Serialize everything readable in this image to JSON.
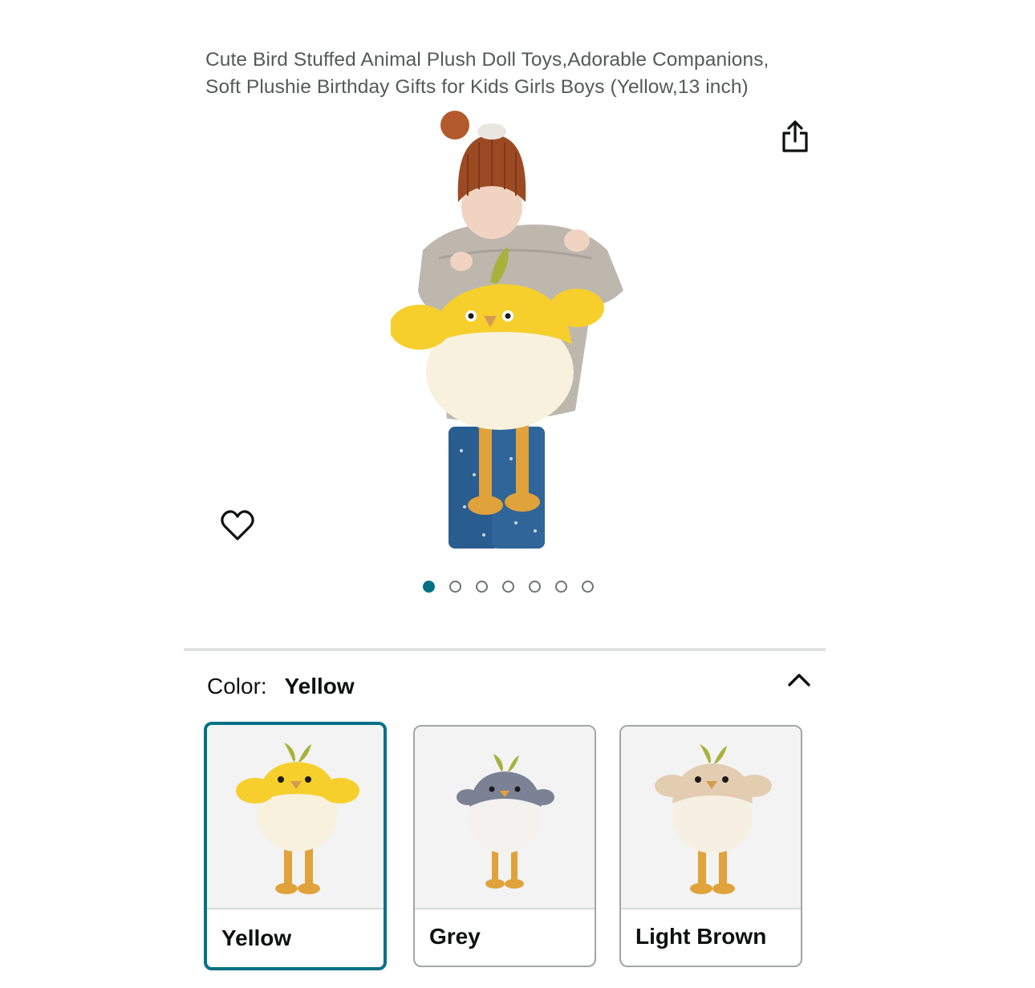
{
  "product": {
    "title": "Cute Bird Stuffed Animal Plush Doll Toys,Adorable Companions, Soft Plushie Birthday Gifts for Kids Girls Boys (Yellow,13 inch)"
  },
  "icons": {
    "share": "share-icon",
    "wishlist": "heart-icon",
    "collapse": "chevron-up-icon"
  },
  "carousel": {
    "total_images": 7,
    "active_index": 0
  },
  "variation": {
    "label": "Color:",
    "selected": "Yellow",
    "options": [
      {
        "name": "Yellow",
        "selected": true
      },
      {
        "name": "Grey",
        "selected": false
      },
      {
        "name": "Light Brown",
        "selected": false
      }
    ]
  },
  "colors": {
    "accent": "#007185",
    "title_text": "#565959",
    "border": "#a2a6a6"
  }
}
